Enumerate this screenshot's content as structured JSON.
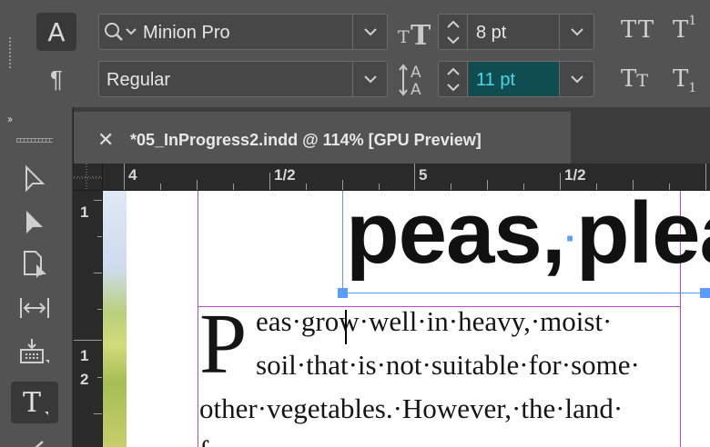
{
  "control_panel": {
    "font_family": "Minion Pro",
    "font_style": "Regular",
    "font_size": "8 pt",
    "leading": "11 pt"
  },
  "document": {
    "tab_title": "*05_InProgress2.indd @ 114% [GPU Preview]"
  },
  "rulers": {
    "horizontal": [
      "4",
      "1/2",
      "5",
      "1/2"
    ],
    "vertical": [
      "1",
      "1",
      "2"
    ]
  },
  "page": {
    "headline_word1": "peas,",
    "headline_word2": "plea",
    "drop_cap": "P",
    "line1": "eas·grow·well·in·heavy,·moist·",
    "line2": "soil·that·is·not·suitable·for·some·",
    "line3": "other·vegetables.·However,·the·land·",
    "line4": "f"
  },
  "icons": {
    "character_mode": "character-formatting-icon",
    "paragraph_mode": "paragraph-formatting-icon",
    "font_search": "search-icon",
    "font_size": "font-size-icon",
    "leading": "leading-icon",
    "all_caps": "all-caps-icon",
    "superscript": "superscript-icon",
    "small_caps": "small-caps-icon",
    "subscript": "subscript-icon"
  },
  "colors": {
    "selection": "#5a9cff",
    "margin_guide": "#b54cc8",
    "leading_highlight": "#0f4d51",
    "leading_text": "#4ad7ea"
  }
}
